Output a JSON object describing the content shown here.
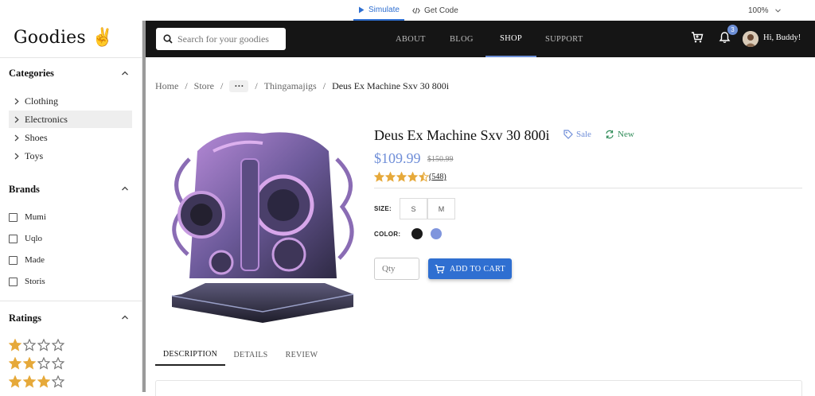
{
  "toolbar": {
    "simulate_label": "Simulate",
    "code_label": "Get Code",
    "zoom": "100%"
  },
  "app": {
    "logo": "Goodies ✌"
  },
  "sidebar": {
    "categories_title": "Categories",
    "categories": [
      {
        "label": "Clothing",
        "active": false
      },
      {
        "label": "Electronics",
        "active": true
      },
      {
        "label": "Shoes",
        "active": false
      },
      {
        "label": "Toys",
        "active": false
      }
    ],
    "brands_title": "Brands",
    "brands": [
      "Mumi",
      "Uqlo",
      "Made",
      "Storis"
    ],
    "ratings_title": "Ratings",
    "ratings": [
      1,
      2,
      3
    ]
  },
  "header": {
    "search_placeholder": "Search for your goodies",
    "nav": [
      {
        "label": "ABOUT",
        "active": false
      },
      {
        "label": "BLOG",
        "active": false
      },
      {
        "label": "SHOP",
        "active": true
      },
      {
        "label": "SUPPORT",
        "active": false
      }
    ],
    "notification_count": "3",
    "greeting": "Hi, Buddy!"
  },
  "breadcrumb": [
    "Home",
    "Store",
    "···",
    "Thingamajigs",
    "Deus Ex Machine Sxv 30 800i"
  ],
  "product": {
    "title": "Deus Ex Machine Sxv 30 800i",
    "sale_label": "Sale",
    "new_label": "New",
    "price": "$109.99",
    "old_price": "$150.99",
    "rating": 4.5,
    "review_count": "(548)",
    "size_label": "SIZE:",
    "sizes": [
      "S",
      "M"
    ],
    "color_label": "COLOR:",
    "colors": [
      "#1a1a1a",
      "#7f95dd"
    ],
    "qty_placeholder": "Qty",
    "add_to_cart_label": "ADD TO CART"
  },
  "tabs": [
    "DESCRIPTION",
    "DETAILS",
    "REVIEW"
  ],
  "colors": {
    "accent": "#2f6fd1",
    "header_bg": "#151515",
    "price": "#6f8ed8",
    "star": "#e6a93a",
    "new": "#2e8b57"
  }
}
